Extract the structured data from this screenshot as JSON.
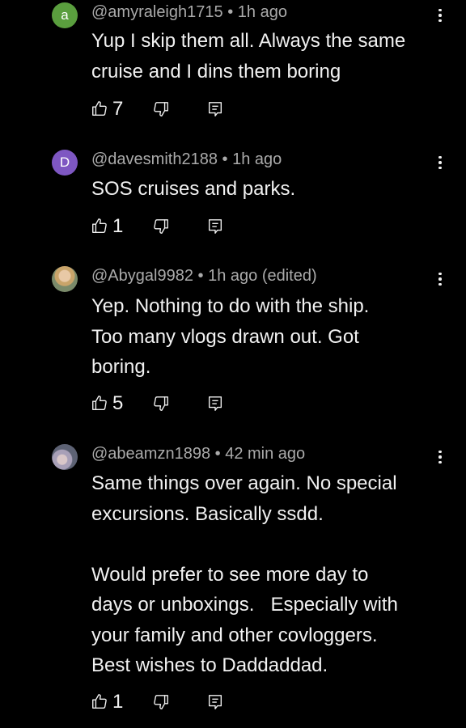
{
  "comments": [
    {
      "avatar_letter": "a",
      "avatar_color": "#5a9e3e",
      "handle": "@amyraleigh1715",
      "separator": "•",
      "time": "1h ago",
      "lines": [
        "Yup I skip them all. Always the same",
        "cruise and I dins them boring"
      ],
      "likes": "7"
    },
    {
      "avatar_letter": "D",
      "avatar_color": "#7e57c2",
      "handle": "@davesmith2188",
      "separator": "•",
      "time": "1h ago",
      "lines": [
        "SOS cruises and parks."
      ],
      "likes": "1"
    },
    {
      "avatar_letter": "",
      "avatar_color": "#b9a27a",
      "handle": "@Abygal9982",
      "separator": "•",
      "time": "1h ago (edited)",
      "lines": [
        "Yep. Nothing to do with the ship.",
        "Too many vlogs drawn out. Got",
        "boring."
      ],
      "likes": "5"
    },
    {
      "avatar_letter": "",
      "avatar_color": "#8a8fa0",
      "handle": "@abeamzn1898",
      "separator": "•",
      "time": "42 min ago",
      "lines": [
        "Same things over again. No special",
        "excursions. Basically ssdd.",
        " ",
        "Would prefer to see more day to",
        "days or unboxings.   Especially with",
        "your family and other covloggers.",
        "Best wishes to Daddaddad."
      ],
      "likes": "1"
    }
  ],
  "icons": {
    "like": "thumbs-up-icon",
    "dislike": "thumbs-down-icon",
    "reply": "reply-comment-icon",
    "menu": "more-vertical-icon"
  }
}
